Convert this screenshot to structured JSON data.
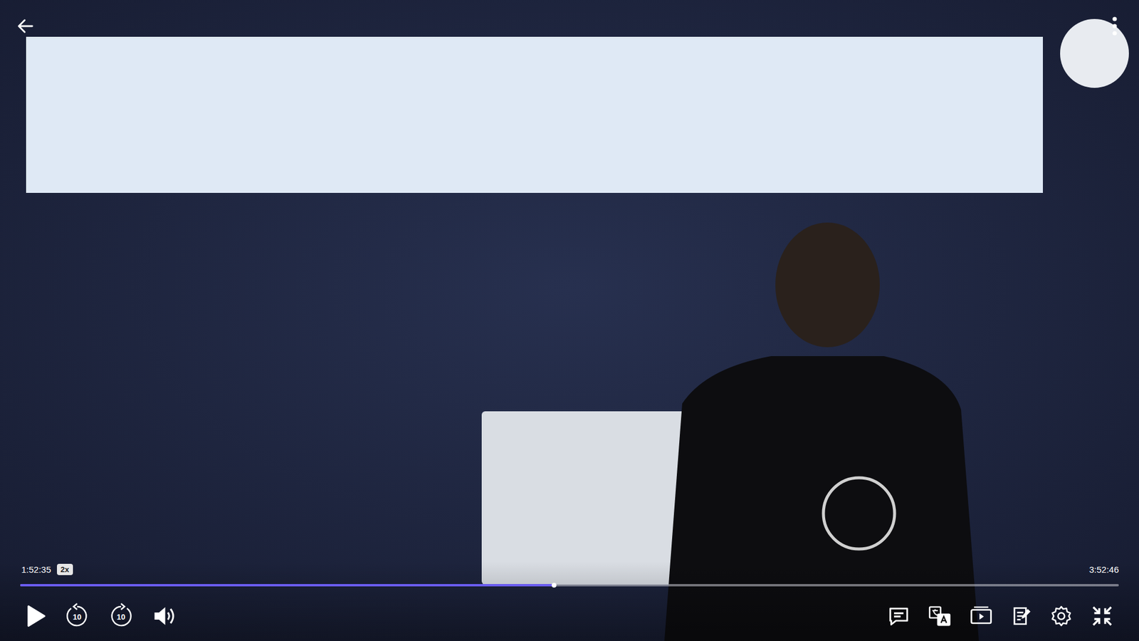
{
  "player": {
    "paused": true,
    "current_time": "1:52:35",
    "speed": "2x",
    "duration": "3:52:46",
    "progress": {
      "level": 0.486
    },
    "controls": {
      "rewind": "10",
      "forward": "10"
    }
  }
}
